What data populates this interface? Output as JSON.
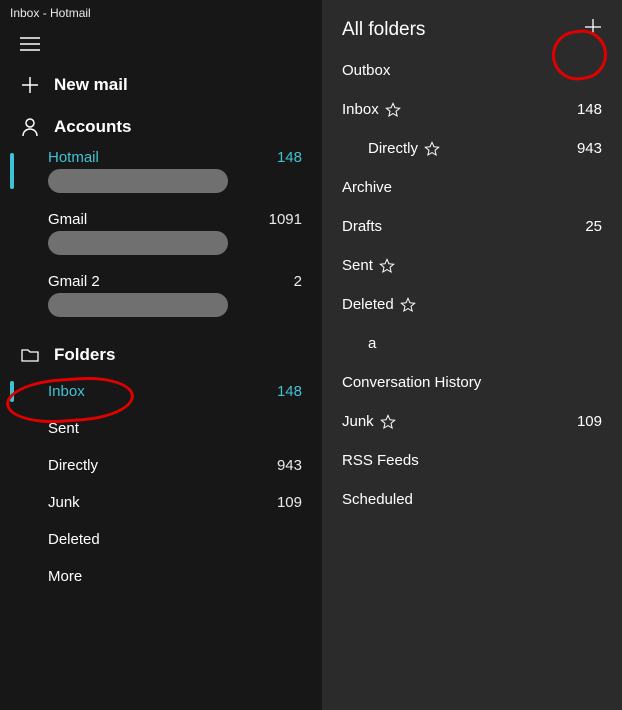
{
  "titlebar": "Inbox - Hotmail",
  "newmail": "New mail",
  "accounts_header": "Accounts",
  "accounts": [
    {
      "name": "Hotmail",
      "count": "148",
      "active": true
    },
    {
      "name": "Gmail",
      "count": "1091",
      "active": false
    },
    {
      "name": "Gmail 2",
      "count": "2",
      "active": false
    }
  ],
  "folders_header": "Folders",
  "folders": [
    {
      "name": "Inbox",
      "count": "148",
      "active": true
    },
    {
      "name": "Sent",
      "count": "",
      "active": false
    },
    {
      "name": "Directly",
      "count": "943",
      "active": false
    },
    {
      "name": "Junk",
      "count": "109",
      "active": false
    },
    {
      "name": "Deleted",
      "count": "",
      "active": false
    },
    {
      "name": "More",
      "count": "",
      "active": false
    }
  ],
  "right": {
    "title": "All folders",
    "items": [
      {
        "name": "Outbox",
        "count": "",
        "star": false,
        "sub": false
      },
      {
        "name": "Inbox",
        "count": "148",
        "star": true,
        "sub": false
      },
      {
        "name": "Directly",
        "count": "943",
        "star": true,
        "sub": true
      },
      {
        "name": "Archive",
        "count": "",
        "star": false,
        "sub": false
      },
      {
        "name": "Drafts",
        "count": "25",
        "star": false,
        "sub": false
      },
      {
        "name": "Sent",
        "count": "",
        "star": true,
        "sub": false
      },
      {
        "name": "Deleted",
        "count": "",
        "star": true,
        "sub": false
      },
      {
        "name": "a",
        "count": "",
        "star": false,
        "sub": true
      },
      {
        "name": "Conversation History",
        "count": "",
        "star": false,
        "sub": false
      },
      {
        "name": "Junk",
        "count": "109",
        "star": true,
        "sub": false
      },
      {
        "name": "RSS Feeds",
        "count": "",
        "star": false,
        "sub": false
      },
      {
        "name": "Scheduled",
        "count": "",
        "star": false,
        "sub": false
      }
    ]
  }
}
